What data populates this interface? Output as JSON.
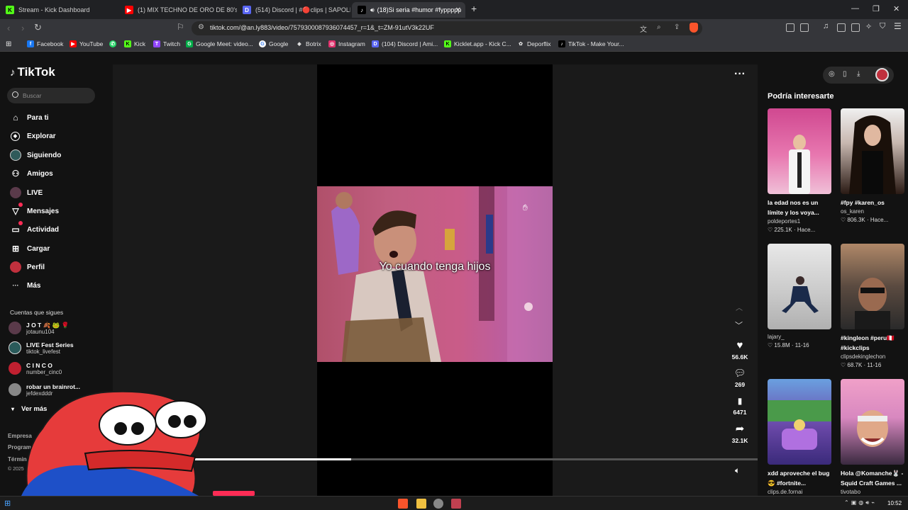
{
  "browser": {
    "tabs": [
      {
        "label": "Stream - Kick Dashboard",
        "color": "#53fc18",
        "glyph": "K"
      },
      {
        "label": "(1) MIX TECHNO DE ORO DE 80's &",
        "color": "#ff0000",
        "glyph": "▶"
      },
      {
        "label": "(514) Discord | #🔴clips | SAPOLIC",
        "color": "#5865f2",
        "glyph": "D"
      },
      {
        "label": "(18)Si seria #humor #fyppppp",
        "color": "#ffffff",
        "glyph": "♪"
      }
    ],
    "url": "tiktok.com/@an.ly883/video/7579300087936074457_r=1&_t=ZM-91utV3k22UF",
    "bookmarks": [
      {
        "label": "Facebook",
        "color": "#1877f2",
        "glyph": "f"
      },
      {
        "label": "YouTube",
        "color": "#ff0000",
        "glyph": "▶"
      },
      {
        "label": "",
        "color": "#25d366",
        "glyph": "✆"
      },
      {
        "label": "Kick",
        "color": "#53fc18",
        "glyph": "K"
      },
      {
        "label": "Twitch",
        "color": "#9146ff",
        "glyph": "T"
      },
      {
        "label": "Google Meet: video...",
        "color": "#00ac47",
        "glyph": "G"
      },
      {
        "label": "Google",
        "color": "#ffffff",
        "glyph": "G"
      },
      {
        "label": "Botrix",
        "color": "#dddddd",
        "glyph": "◆"
      },
      {
        "label": "Instagram",
        "color": "#e1306c",
        "glyph": "◎"
      },
      {
        "label": "(104) Discord | Ami...",
        "color": "#5865f2",
        "glyph": "D"
      },
      {
        "label": "Kicklet.app - Kick C...",
        "color": "#53fc18",
        "glyph": "K"
      },
      {
        "label": "Deporflix",
        "color": "#dddddd",
        "glyph": "✿"
      },
      {
        "label": "TikTok - Make Your...",
        "color": "#ffffff",
        "glyph": "♪"
      }
    ]
  },
  "sidebar": {
    "logo": "TikTok",
    "search_placeholder": "Buscar",
    "nav": [
      {
        "label": "Para ti",
        "icon": "home-icon",
        "glyph": "⌂"
      },
      {
        "label": "Explorar",
        "icon": "compass-icon",
        "glyph": "◎"
      },
      {
        "label": "Siguiendo",
        "icon": "following-avatar",
        "glyph": "◉"
      },
      {
        "label": "Amigos",
        "icon": "friends-icon",
        "glyph": "⚇"
      },
      {
        "label": "LIVE",
        "icon": "live-avatar",
        "glyph": "●"
      },
      {
        "label": "Mensajes",
        "icon": "messages-icon",
        "glyph": "▽"
      },
      {
        "label": "Actividad",
        "icon": "activity-icon",
        "glyph": "▭"
      },
      {
        "label": "Cargar",
        "icon": "upload-icon",
        "glyph": "⊞"
      },
      {
        "label": "Perfil",
        "icon": "profile-avatar",
        "glyph": "●"
      },
      {
        "label": "Más",
        "icon": "more-icon",
        "glyph": "···"
      }
    ],
    "following_title": "Cuentas que sigues",
    "following": [
      {
        "name": "J O T 🍂 🐸 🌹",
        "user": "jotaunu104",
        "color": "#5a3a4a"
      },
      {
        "name": "LIVE Fest Series",
        "user": "tiktok_livefest",
        "color": "#2a5a5a"
      },
      {
        "name": "C I N C O",
        "user": "number_cinc0",
        "color": "#c02030"
      },
      {
        "name": "robar un brainrot...",
        "user": "jefdexdddr",
        "color": "#888888"
      }
    ],
    "see_more": "Ver más",
    "footer": [
      "Empresa",
      "Program",
      "Términ",
      "© 2025"
    ]
  },
  "video": {
    "caption": "Yo cuando tenga hijos",
    "progress": 0.37,
    "actions": [
      {
        "icon": "heart-icon",
        "glyph": "♥",
        "count": "56.6K"
      },
      {
        "icon": "comment-icon",
        "glyph": "●",
        "count": "269"
      },
      {
        "icon": "bookmark-icon",
        "glyph": "▮",
        "count": "6471"
      },
      {
        "icon": "share-icon",
        "glyph": "➦",
        "count": "32.1K"
      }
    ]
  },
  "recommendations": {
    "title": "Podría interesarte",
    "cards": [
      {
        "title": "la edad nos es un límite y los voya...",
        "user": "poldeportes1",
        "stats": "♡ 225.1K · Hace...",
        "bg": "linear-gradient(180deg,#d04890,#e878b0 55%,#f0c0d8)"
      },
      {
        "title": "#fpy #karen_os",
        "user": "os_karen",
        "stats": "♡ 806.3K · Hace...",
        "bg": "linear-gradient(180deg,#f0f0f0,#c8b8b0 40%,#2a1a14 100%)"
      },
      {
        "title": "",
        "user": "lajary_",
        "stats": "♡ 15.8M · 11-16",
        "bg": "linear-gradient(180deg,#e8e8e8,#c8c8c8 60%,#b0b0b0)"
      },
      {
        "title": "#kingleon #peru🇵🇪 #kickclips",
        "user": "clipsdekinglechon",
        "stats": "♡ 68.7K · 11-16",
        "bg": "linear-gradient(180deg,#b08868,#5a4a40 50%,#2a2a2a)"
      },
      {
        "title": "xdd aproveche el bug😎 #fortnite...",
        "user": "clips.de.fornai",
        "stats": "",
        "bg": "linear-gradient(180deg,#6aa0e0,#6a48a8 55%,#3a2a7a)"
      },
      {
        "title": "Hola @Komanche🐰 - Squid Craft Games ...",
        "user": "tivotabo",
        "stats": "",
        "bg": "linear-gradient(180deg,#f0a0c8,#d888c0 45%,#3a2a40)"
      }
    ]
  }
}
